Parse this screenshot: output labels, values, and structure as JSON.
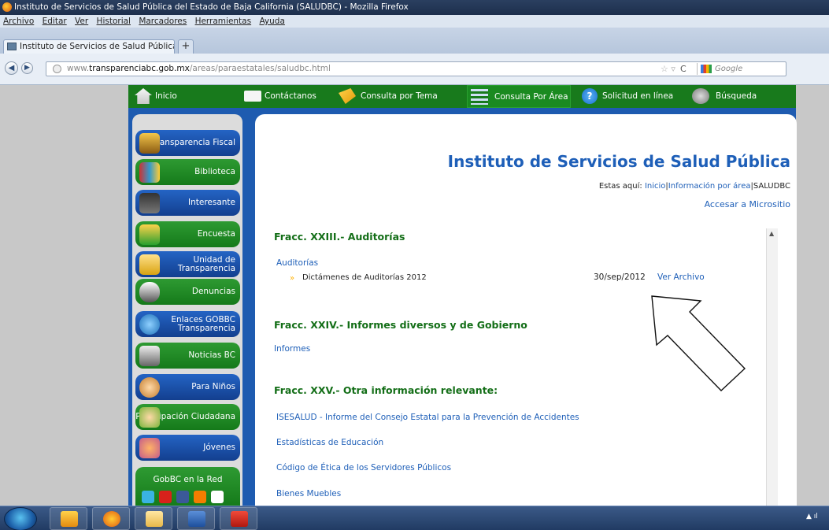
{
  "window": {
    "title": "Instituto de Servicios de Salud Pública del Estado de Baja California (SALUDBC) - Mozilla Firefox"
  },
  "menu": [
    "Archivo",
    "Editar",
    "Ver",
    "Historial",
    "Marcadores",
    "Herramientas",
    "Ayuda"
  ],
  "tab": {
    "label": "Instituto de Servicios de Salud Pública d...",
    "new_tab": "+"
  },
  "address": {
    "prefix": "www.",
    "domain": "transparenciabc.gob.mx",
    "path": "/areas/paraestatales/saludbc.html",
    "search_placeholder": "Google"
  },
  "topnav": [
    "Inicio",
    "Contáctanos",
    "Consulta por Tema",
    "Consulta Por Área",
    "Solicitud en línea",
    "Búsqueda"
  ],
  "sidebar": [
    "Transparencia Fiscal",
    "Biblioteca",
    "Interesante",
    "Encuesta",
    "Unidad de Transparencia",
    "Denuncias",
    "Enlaces GOBBC Transparencia",
    "Noticias BC",
    "Para Niños",
    "Participación Ciudadana",
    "Jóvenes"
  ],
  "sidebar_footer": "GobBC en la Red",
  "content": {
    "title": "Instituto de Servicios de Salud Pública",
    "breadcrumb": {
      "prefix": "Estas aquí:",
      "inicio": "Inicio",
      "area": "Información por área",
      "current": "SALUDBC"
    },
    "microsite": "Accesar a Micrositio",
    "sec23": "Fracc. XXIII.- Auditorías",
    "auditorias": "Auditorías",
    "dictamenes": "Dictámenes de Auditorías 2012",
    "date": "30/sep/2012",
    "ver_archivo": "Ver Archivo",
    "sec24": "Fracc. XXIV.- Informes diversos y de Gobierno",
    "informes": "Informes",
    "sec25": "Fracc. XXV.- Otra información relevante:",
    "links25": [
      "ISESALUD - Informe del Consejo Estatal para la Prevención de Accidentes",
      "Estadísticas de Educación",
      "Código de Ética de los Servidores Públicos",
      "Bienes Muebles"
    ]
  },
  "colors": {
    "green": "#187a1c",
    "blue": "#1e5bb0",
    "link": "#1e5fb8",
    "heading": "#136e17"
  }
}
